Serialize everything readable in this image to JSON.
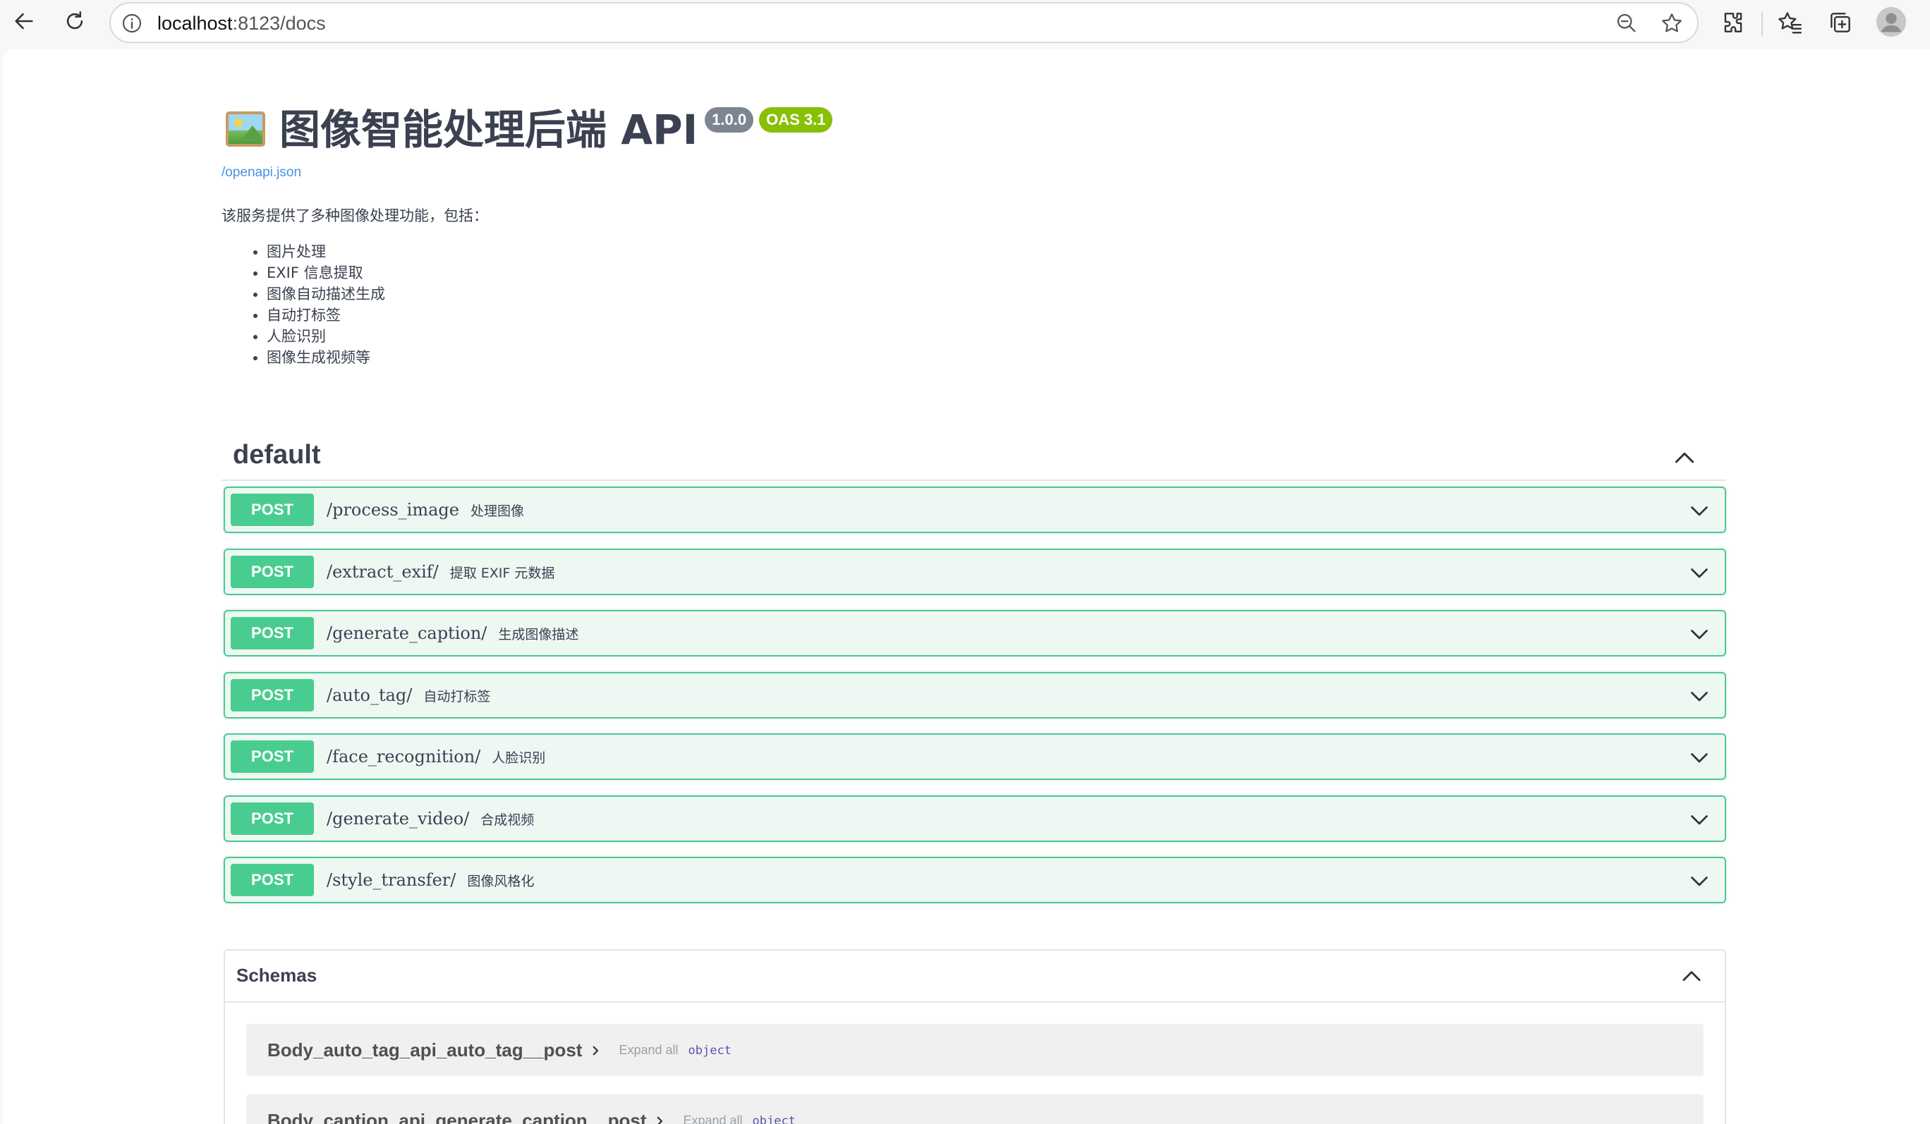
{
  "browser": {
    "url_host": "localhost",
    "url_path": ":8123/docs"
  },
  "info": {
    "title": "图像智能处理后端 API",
    "version_badge": "1.0.0",
    "oas_badge": "OAS 3.1",
    "spec_link": "/openapi.json",
    "description": "该服务提供了多种图像处理功能，包括：",
    "features": [
      "图片处理",
      "EXIF 信息提取",
      "图像自动描述生成",
      "自动打标签",
      "人脸识别",
      "图像生成视频等"
    ]
  },
  "tag": {
    "name": "default"
  },
  "operations": [
    {
      "method": "POST",
      "path": "/process_image",
      "summary": "处理图像"
    },
    {
      "method": "POST",
      "path": "/extract_exif/",
      "summary": "提取 EXIF 元数据"
    },
    {
      "method": "POST",
      "path": "/generate_caption/",
      "summary": "生成图像描述"
    },
    {
      "method": "POST",
      "path": "/auto_tag/",
      "summary": "自动打标签"
    },
    {
      "method": "POST",
      "path": "/face_recognition/",
      "summary": "人脸识别"
    },
    {
      "method": "POST",
      "path": "/generate_video/",
      "summary": "合成视频"
    },
    {
      "method": "POST",
      "path": "/style_transfer/",
      "summary": "图像风格化"
    }
  ],
  "schemas": {
    "title": "Schemas",
    "models": [
      {
        "name": "Body_auto_tag_api_auto_tag__post",
        "expand_label": "Expand all",
        "type": "object"
      },
      {
        "name": "Body_caption_api_generate_caption__post",
        "expand_label": "Expand all",
        "type": "object"
      }
    ]
  },
  "colors": {
    "post_green": "#49cc90",
    "post_bg": "#edf8f3",
    "version_badge": "#7d8492",
    "oas_badge": "#89bf04",
    "link": "#4990e2"
  },
  "icons": [
    "back-arrow-icon",
    "reload-icon",
    "info-icon",
    "zoom-out-icon",
    "star-icon",
    "extensions-icon",
    "favorites-icon",
    "collections-icon",
    "profile-avatar-icon",
    "chevron-up-icon",
    "chevron-down-icon",
    "chevron-right-icon",
    "image-emoji-icon"
  ]
}
